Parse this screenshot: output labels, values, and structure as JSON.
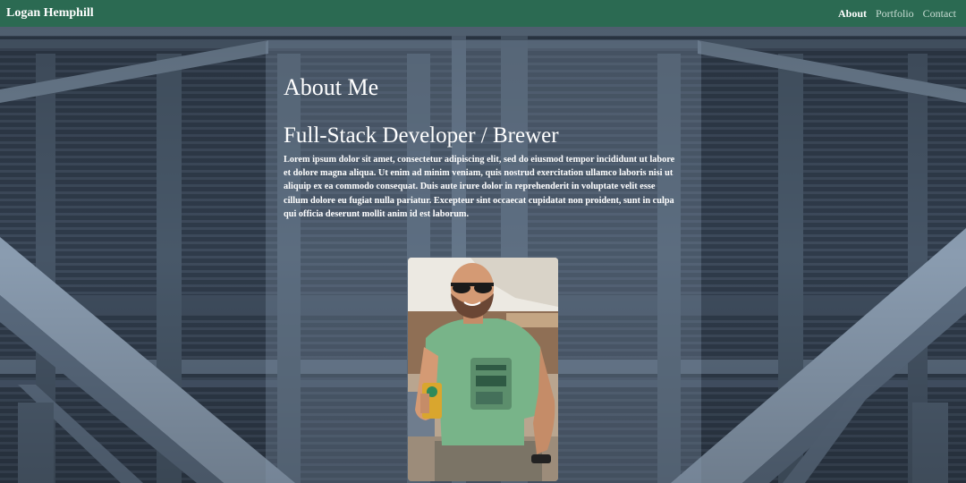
{
  "navbar": {
    "brand": "Logan Hemphill",
    "links": [
      {
        "label": "About",
        "active": true
      },
      {
        "label": "Portfolio",
        "active": false
      },
      {
        "label": "Contact",
        "active": false
      }
    ]
  },
  "main": {
    "title": "About Me",
    "subtitle": "Full-Stack Developer / Brewer",
    "bio": "Lorem ipsum dolor sit amet, consectetur adipiscing elit, sed do eiusmod tempor incididunt ut labore et dolore magna aliqua. Ut enim ad minim veniam, quis nostrud exercitation ullamco laboris nisi ut aliquip ex ea commodo consequat. Duis aute irure dolor in reprehenderit in voluptate velit esse cillum dolore eu fugiat nulla pariatur. Excepteur sint occaecat cupidatat non proident, sunt in culpa qui officia deserunt mollit anim id est laborum."
  },
  "colors": {
    "navbar": "#2b6a52",
    "background": "#3a4656",
    "card_overlay": "rgba(130,150,170,0.32)",
    "text": "#ffffff"
  },
  "images": {
    "background": "steel-bridge-underside-photo",
    "portrait": "man-in-green-tshirt-with-sunglasses-holding-beer-photo"
  }
}
